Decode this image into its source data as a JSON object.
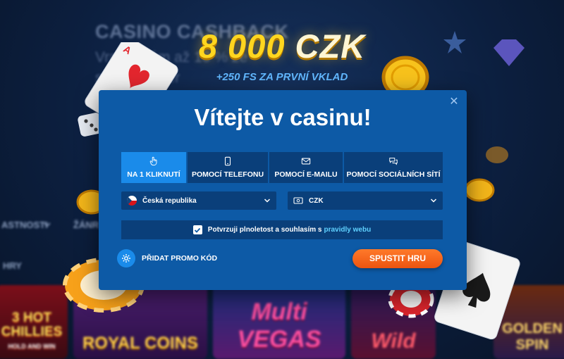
{
  "background": {
    "promo_title": "CASINO CASHBACK",
    "promo_text": "Vraťte Vám až 10 % ze svých proher",
    "nav_items": [
      "ASTNOSTI",
      "ŽÁNR"
    ],
    "games_label": "HRY",
    "game_tiles": [
      {
        "name": "3 HOT CHILLIES",
        "sub": "HOLD AND WIN"
      },
      {
        "name": "ROYAL COINS"
      },
      {
        "name": "Multi VEGAS"
      },
      {
        "name": "Wild"
      },
      {
        "name": "GOLDEN SPIN"
      }
    ]
  },
  "hero": {
    "amount": "8 000",
    "currency": "CZK",
    "subtitle": "+250 FS ZA PRVNÍ VKLAD"
  },
  "modal": {
    "title": "Vítejte v casinu!",
    "close_icon": "close-icon",
    "tabs": [
      {
        "label": "NA 1 KLIKNUTÍ",
        "icon": "hand-pointer-icon",
        "active": true
      },
      {
        "label": "POMOCÍ TELEFONU",
        "icon": "phone-icon",
        "active": false
      },
      {
        "label": "POMOCÍ E-MAILU",
        "icon": "envelope-icon",
        "active": false
      },
      {
        "label": "POMOCÍ SOCIÁLNÍCH SÍTÍ",
        "icon": "chat-bubbles-icon",
        "active": false
      }
    ],
    "country_select": {
      "value": "Česká republika",
      "icon": "czech-flag-icon"
    },
    "currency_select": {
      "value": "CZK",
      "icon": "money-icon"
    },
    "consent": {
      "checked": true,
      "text": "Potvrzuji plnoletost a souhlasím s",
      "link": "pravidly webu"
    },
    "promo_code_label": "PŘIDAT PROMO KÓD",
    "submit_label": "SPUSTIT HRU"
  },
  "colors": {
    "modal_bg": "#0d5aa6",
    "tab_active": "#1a8bea",
    "field_bg": "#0a3f7a",
    "cta": "#ff6a1a",
    "hero_gold": "#ffd61f",
    "link": "#5fd1ff"
  }
}
